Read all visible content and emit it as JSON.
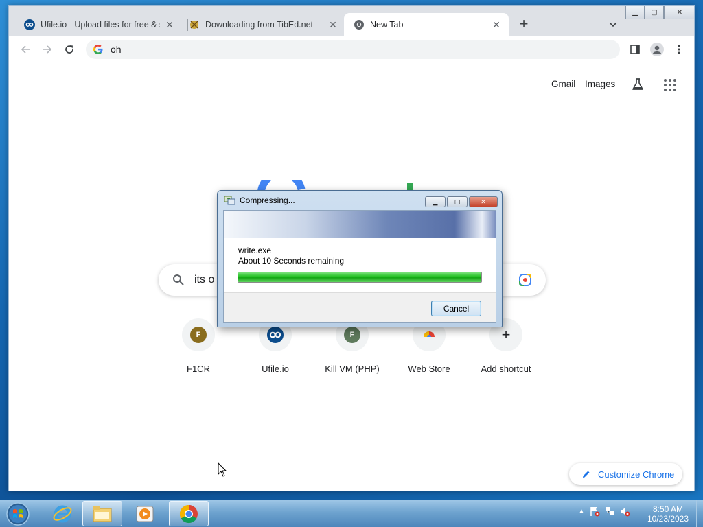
{
  "browser": {
    "tabs": [
      {
        "title": "Ufile.io - Upload files for free & s",
        "active": false
      },
      {
        "title": "Downloading from TibEd.net",
        "active": false
      },
      {
        "title": "New Tab",
        "active": true
      }
    ],
    "omnibox_value": "oh"
  },
  "ntp": {
    "links": {
      "gmail": "Gmail",
      "images": "Images"
    },
    "search_value": "its o",
    "shortcuts": [
      {
        "label": "F1CR",
        "letter": "F",
        "color": "#8a6d1e"
      },
      {
        "label": "Ufile.io",
        "letter": "",
        "color": "#0b4c8c"
      },
      {
        "label": "Kill VM (PHP)",
        "letter": "F",
        "color": "#5e7a5c"
      },
      {
        "label": "Web Store",
        "letter": "",
        "color": "#e8453c"
      },
      {
        "label": "Add shortcut",
        "letter": "+",
        "color": "#202124"
      }
    ],
    "customize_label": "Customize Chrome"
  },
  "dialog": {
    "title": "Compressing...",
    "file": "write.exe",
    "remaining": "About 10 Seconds remaining",
    "progress": 1.0,
    "cancel_label": "Cancel"
  },
  "taskbar": {
    "time": "8:50 AM",
    "date": "10/23/2023",
    "items": [
      "internet-explorer",
      "file-explorer",
      "media-player",
      "chrome"
    ]
  },
  "colors": {
    "google_blue": "#4285f4",
    "google_green": "#34a853",
    "accent": "#1a73e8"
  }
}
